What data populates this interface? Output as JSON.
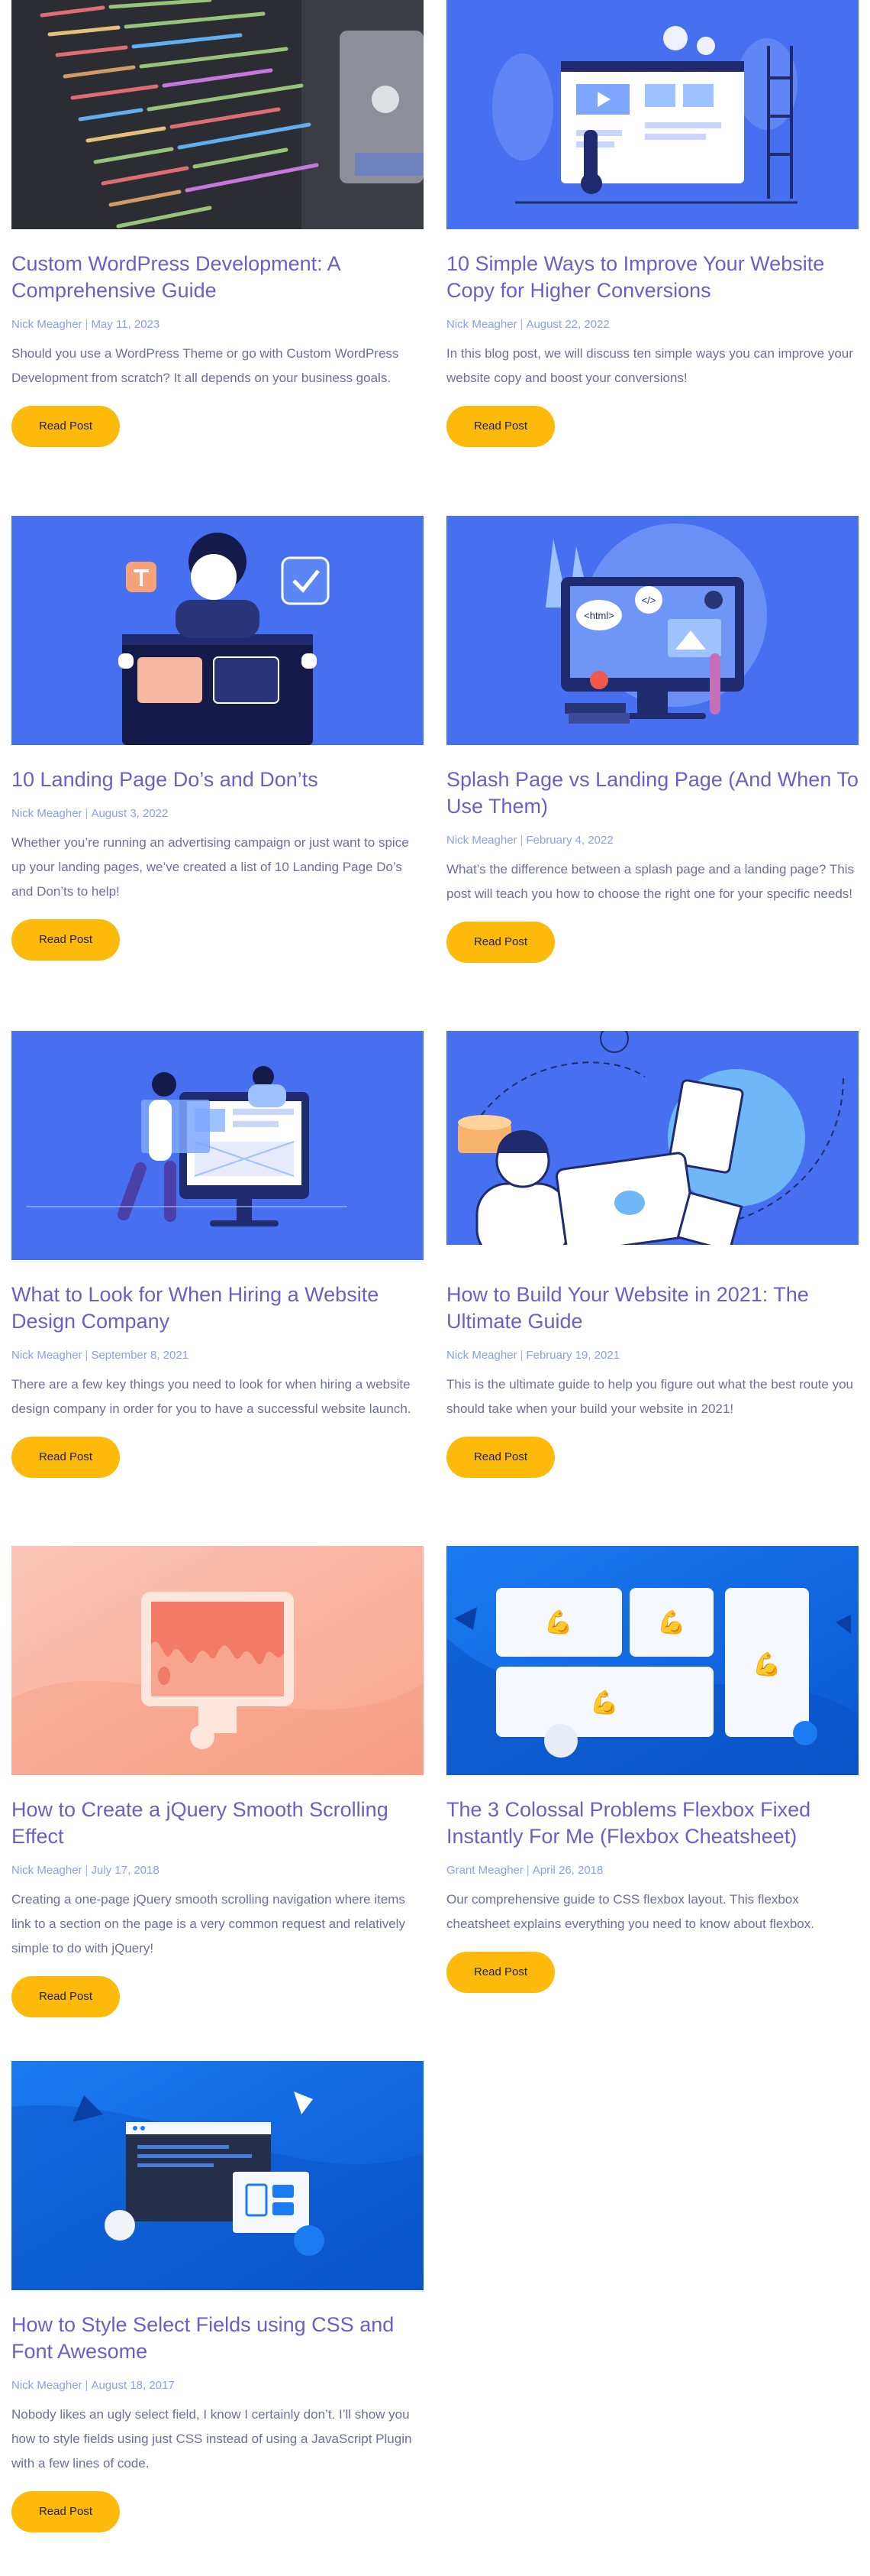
{
  "posts": [
    {
      "title": "Custom WordPress Development: A Comprehensive Guide",
      "author": "Nick Meagher",
      "date": "May 11, 2023",
      "excerpt": "Should you use a WordPress Theme or go with Custom WordPress Development from scratch? It all depends on your business goals.",
      "button": "Read Post",
      "image": "code-screen-photo"
    },
    {
      "title": "10 Simple Ways to Improve Your Website Copy for Higher Conversions",
      "author": "Nick Meagher",
      "date": "August 22, 2022",
      "excerpt": "In this blog post, we will discuss ten simple ways you can improve your website copy and boost your conversions!",
      "button": "Read Post",
      "image": "website-builders-illustration"
    },
    {
      "title": "10 Landing Page Do’s and Don’ts",
      "author": "Nick Meagher",
      "date": "August 3, 2022",
      "excerpt": "Whether you’re running an advertising campaign or just want to spice up your landing pages, we’ve created a list of 10 Landing Page Do’s and Don’ts to help!",
      "button": "Read Post",
      "image": "landing-page-illustration"
    },
    {
      "title": "Splash Page vs Landing Page (And When To Use Them)",
      "author": "Nick Meagher",
      "date": "February 4, 2022",
      "excerpt": "What’s the difference between a splash page and a landing page? This post will teach you how to choose the right one for your specific needs!",
      "button": "Read Post",
      "image": "html-monitor-illustration",
      "labels": [
        "<html>",
        "</>"
      ]
    },
    {
      "title": "What to Look for When Hiring a Website Design Company",
      "author": "Nick Meagher",
      "date": "September 8, 2021",
      "excerpt": "There are a few key things you need to look for when hiring a website design company in order for you to have a successful website launch.",
      "button": "Read Post",
      "image": "designers-monitor-illustration"
    },
    {
      "title": "How to Build Your Website in 2021: The Ultimate Guide",
      "author": "Nick Meagher",
      "date": "February 19, 2021",
      "excerpt": "This is the ultimate guide to help you figure out what the best route you should take when your build your website in 2021!",
      "button": "Read Post",
      "image": "laptop-person-illustration"
    },
    {
      "title": "How to Create a jQuery Smooth Scrolling Effect",
      "author": "Nick Meagher",
      "date": "July 17, 2018",
      "excerpt": "Creating a one-page jQuery smooth scrolling navigation where items link to a section on the page is a very common request and relatively simple to do with jQuery!",
      "button": "Read Post",
      "image": "dripping-monitor-illustration"
    },
    {
      "title": "The 3 Colossal Problems Flexbox Fixed Instantly For Me (Flexbox Cheatsheet)",
      "author": "Grant Meagher",
      "date": "April 26, 2018",
      "excerpt": "Our comprehensive guide to CSS flexbox layout. This flexbox cheatsheet explains everything you need to know about flexbox.",
      "button": "Read Post",
      "image": "flexbox-boxes-illustration",
      "emoji": "💪"
    },
    {
      "title": "How to Style Select Fields using CSS and Font Awesome",
      "author": "Nick Meagher",
      "date": "August 18, 2017",
      "excerpt": "Nobody likes an ugly select field, I know I certainly don’t. I’ll show you how to style fields using just CSS instead of using a JavaScript Plugin with a few lines of code.",
      "button": "Read Post",
      "image": "browser-window-illustration"
    }
  ],
  "colors": {
    "title": "#6b5ec7",
    "meta": "#8aa0e8",
    "excerpt": "#6b6f9a",
    "button": "#fdba0b",
    "blue": "#3f6ff2"
  }
}
